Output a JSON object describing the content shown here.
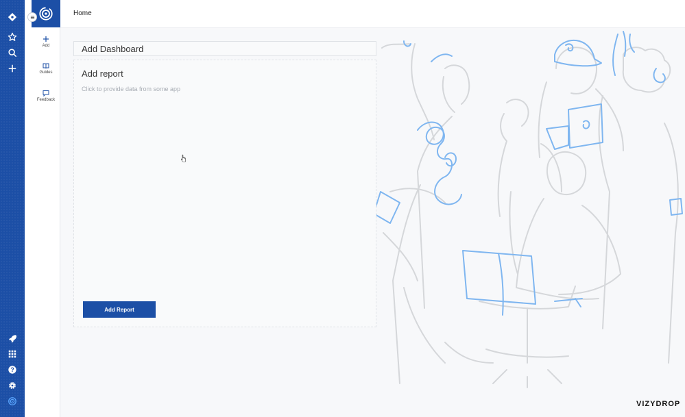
{
  "rail": {
    "icons": [
      "diamond-logo-icon",
      "star-icon",
      "search-icon",
      "plus-icon",
      "rocket-icon",
      "apps-grid-icon",
      "help-icon",
      "gear-icon",
      "vizydrop-icon"
    ]
  },
  "sidebar": {
    "tools": [
      {
        "icon": "plus-icon",
        "label": "Add"
      },
      {
        "icon": "book-icon",
        "label": "Guides"
      },
      {
        "icon": "chat-icon",
        "label": "Feedback"
      }
    ]
  },
  "header": {
    "breadcrumb": "Home"
  },
  "dashboard": {
    "title": "Add Dashboard",
    "report": {
      "title": "Add report",
      "subtitle": "Click to provide data from some app",
      "button_label": "Add Report"
    }
  },
  "footer": {
    "logo": "VIZYDROP"
  },
  "colors": {
    "brand": "#1c4fa6",
    "accent_illustration": "#7fb6f0",
    "line_illustration": "#d5d7da"
  }
}
